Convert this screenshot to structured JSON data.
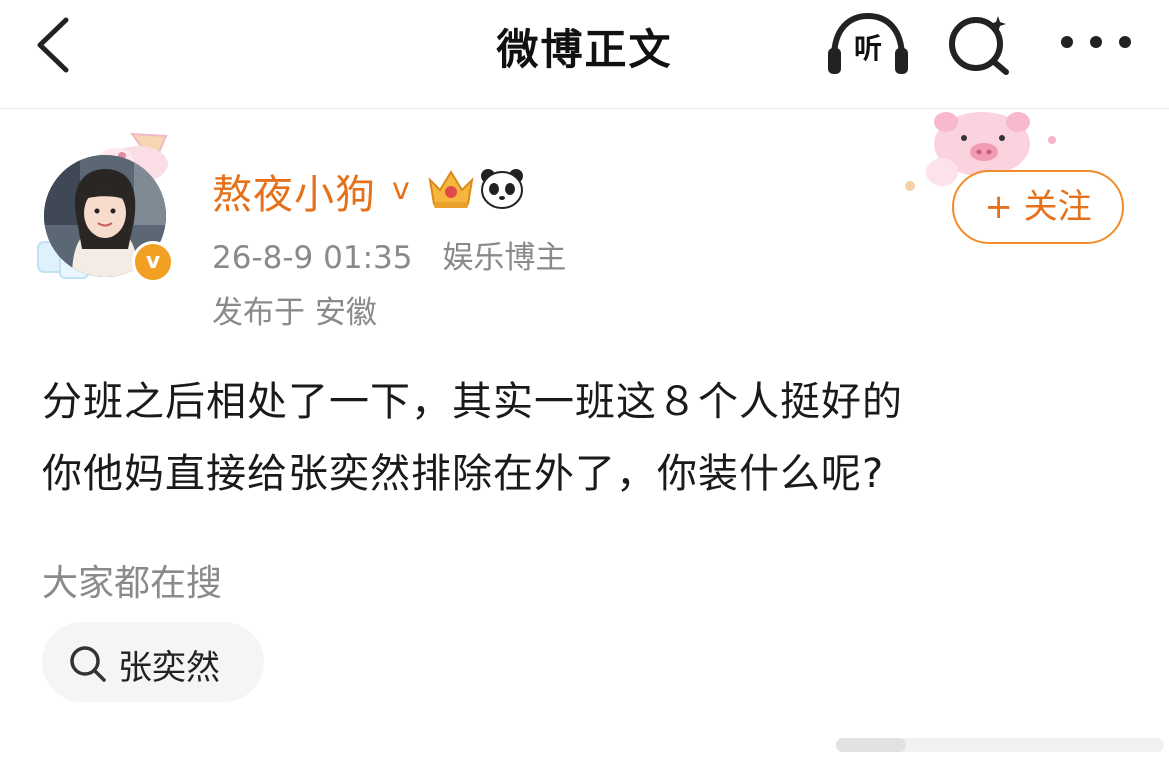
{
  "header": {
    "title": "微博正文",
    "listen_label": "听"
  },
  "post": {
    "author": {
      "name": "熬夜小狗",
      "vip_mark": "v",
      "verify_mark": "v"
    },
    "timestamp": "26-8-9 01:35",
    "author_tag": "娱乐博主",
    "location": "发布于 安徽",
    "follow_label": "+ 关注",
    "body_lines": [
      "分班之后相处了一下，其实一班这８个人挺好的",
      "你他妈直接给张奕然排除在外了，你装什么呢?"
    ]
  },
  "hot_search": {
    "title": "大家都在搜",
    "tags": [
      {
        "label": "张奕然"
      }
    ]
  },
  "colors": {
    "accent": "#e5711a",
    "follow_border": "#f28b2b",
    "meta_text": "#8a8a8a",
    "verify_badge": "#f2a024"
  }
}
